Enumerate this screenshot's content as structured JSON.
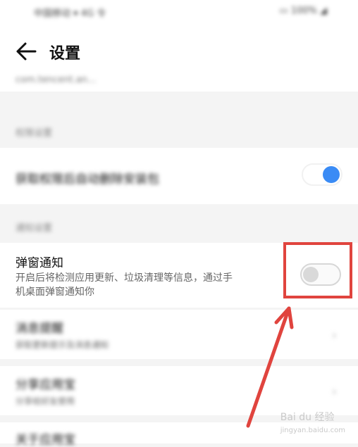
{
  "status_bar": {
    "left": "中国移动 ▾ 4G 令",
    "right": "▭ 100% ◢"
  },
  "header": {
    "title": "设置"
  },
  "overflow_text": "com.tencent.an...",
  "sections": {
    "s1_header": "权限设置",
    "s1_row_title": "获取权限后自动删除安装包",
    "s1_toggle_on": true,
    "s2_header": "通知设置"
  },
  "popup_notify": {
    "title": "弹窗通知",
    "desc_line1": "开启后将检测应用更新、垃圾清理等信息，通过手",
    "desc_line2": "机桌面弹窗通知你",
    "enabled": false
  },
  "blurred_rows": [
    {
      "title": "消息提醒",
      "desc": "获取更新提示及消息通知"
    },
    {
      "title": "分享应用宝",
      "desc": "分享给好友使用"
    },
    {
      "title": "关于应用宝"
    }
  ],
  "watermark": {
    "main": "Bai du 经验",
    "sub": "jingyan.baidu.com"
  },
  "colors": {
    "accent_blue": "#3a8bf5",
    "highlight_red": "#e0443e"
  }
}
